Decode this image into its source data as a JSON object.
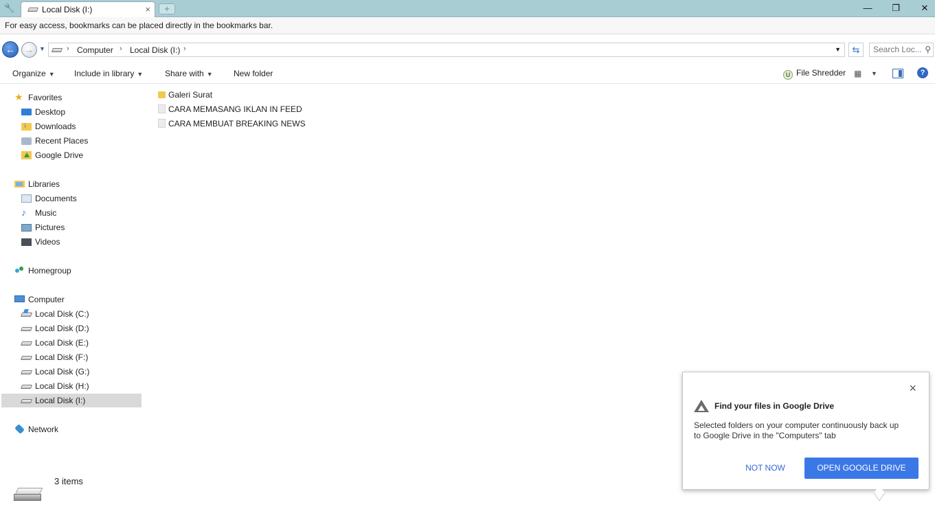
{
  "browser": {
    "tab_title": "Local Disk (I:)",
    "tab_close": "×",
    "new_tab": "+",
    "minimize": "—",
    "restore": "❐",
    "close": "✕",
    "bookmarks_hint": "For easy access, bookmarks can be placed directly in the bookmarks bar."
  },
  "address": {
    "crumbs": [
      "Computer",
      "Local Disk (I:)"
    ],
    "separator": "›",
    "search_placeholder": "Search Loc..."
  },
  "toolbar": {
    "organize": "Organize",
    "include_in_library": "Include in library",
    "share_with": "Share with",
    "new_folder": "New folder",
    "file_shredder": "File Shredder",
    "file_shredder_icon": "U"
  },
  "nav": {
    "favorites": "Favorites",
    "desktop": "Desktop",
    "downloads": "Downloads",
    "recent_places": "Recent Places",
    "google_drive": "Google Drive",
    "libraries": "Libraries",
    "documents": "Documents",
    "music": "Music",
    "pictures": "Pictures",
    "videos": "Videos",
    "homegroup": "Homegroup",
    "computer": "Computer",
    "disks": [
      "Local Disk (C:)",
      "Local Disk (D:)",
      "Local Disk (E:)",
      "Local Disk (F:)",
      "Local Disk (G:)",
      "Local Disk (H:)",
      "Local Disk (I:)"
    ],
    "network": "Network"
  },
  "files": [
    {
      "name": "Galeri Surat",
      "type": "folder"
    },
    {
      "name": "CARA MEMASANG IKLAN IN FEED",
      "type": "file"
    },
    {
      "name": "CARA MEMBUAT BREAKING NEWS",
      "type": "file"
    }
  ],
  "status": {
    "item_count": "3 items"
  },
  "popup": {
    "title": "Find your files in Google Drive",
    "body": "Selected folders on your computer continuously back up to Google Drive in the \"Computers\" tab",
    "not_now": "NOT NOW",
    "open_drive": "OPEN GOOGLE DRIVE",
    "close": "×"
  },
  "colors": {
    "titlebar": "#a8cdd3",
    "primary_button": "#3b78e7",
    "link_button": "#3367d6",
    "selection": "#d9d9d9"
  }
}
